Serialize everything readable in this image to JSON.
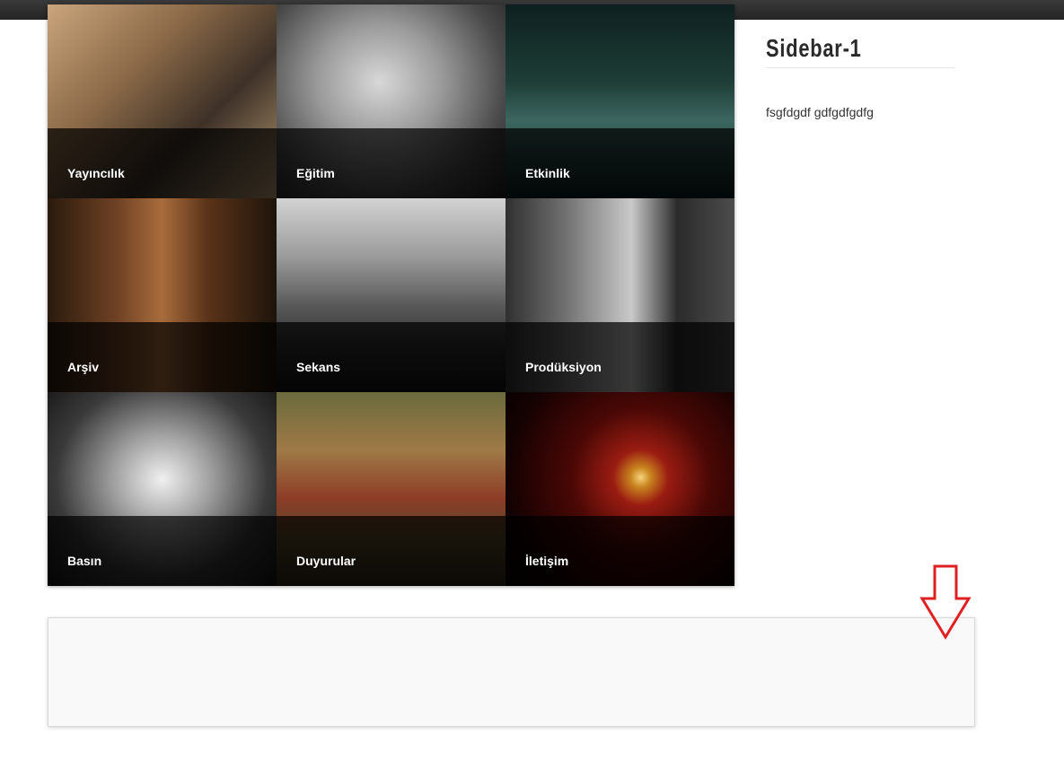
{
  "tiles": [
    {
      "label": "Yayıncılık"
    },
    {
      "label": "Eğitim"
    },
    {
      "label": "Etkinlik"
    },
    {
      "label": "Arşiv"
    },
    {
      "label": "Sekans"
    },
    {
      "label": "Prodüksiyon"
    },
    {
      "label": "Basın"
    },
    {
      "label": "Duyurular"
    },
    {
      "label": "İletişim"
    }
  ],
  "sidebar": {
    "title": "Sidebar-1",
    "text": "fsgfdgdf gdfgdfgdfg"
  },
  "annotation": {
    "icon": "down-arrow-icon",
    "color": "#e02020"
  }
}
